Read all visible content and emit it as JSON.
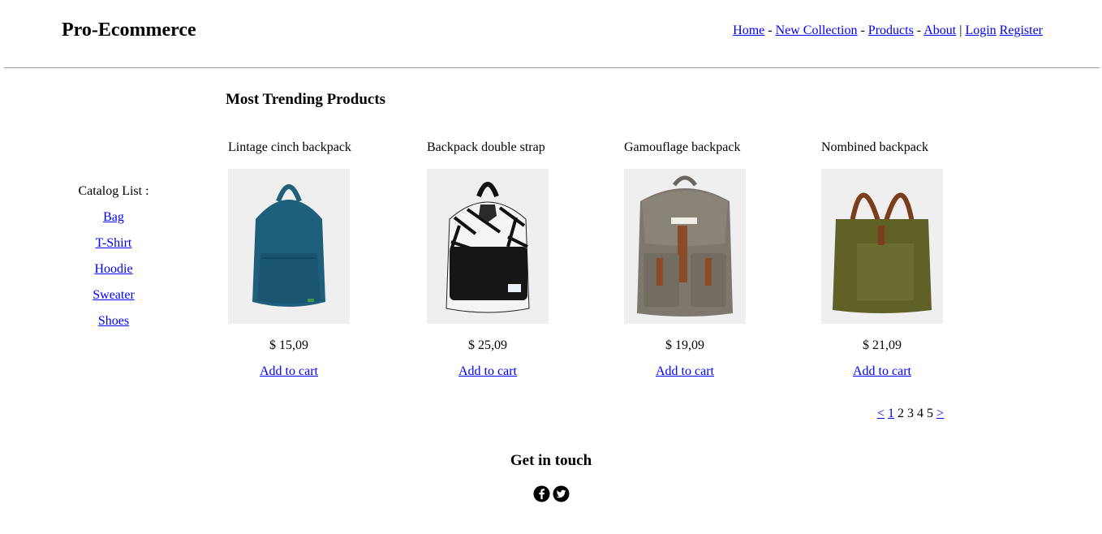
{
  "header": {
    "brand": "Pro-Ecommerce",
    "nav": {
      "home": "Home",
      "new_collection": "New Collection",
      "products": "Products",
      "about": "About",
      "login": "Login",
      "register": "Register",
      "dash": "-",
      "pipe": "|"
    }
  },
  "main": {
    "title": "Most Trending Products",
    "products": [
      {
        "name": "Lintage cinch backpack",
        "price": "$ 15,09",
        "cart_label": "Add to cart"
      },
      {
        "name": "Backpack double strap",
        "price": "$ 25,09",
        "cart_label": "Add to cart"
      },
      {
        "name": "Gamouflage backpack",
        "price": "$ 19,09",
        "cart_label": "Add to cart"
      },
      {
        "name": "Nombined backpack",
        "price": "$ 21,09",
        "cart_label": "Add to cart"
      }
    ],
    "pagination": {
      "prev": "<",
      "pages": [
        "1",
        "2",
        "3",
        "4",
        "5"
      ],
      "next": ">"
    }
  },
  "sidebar": {
    "title": "Catalog List :",
    "items": [
      "Bag",
      "T-Shirt",
      "Hoodie",
      "Sweater",
      "Shoes"
    ]
  },
  "footer": {
    "title": "Get in touch",
    "social": [
      "facebook-icon",
      "twitter-icon"
    ]
  },
  "colors": {
    "link": "#0000ee",
    "text": "#000000",
    "rule": "#9a9a9a",
    "image_bg": "#efefef"
  }
}
